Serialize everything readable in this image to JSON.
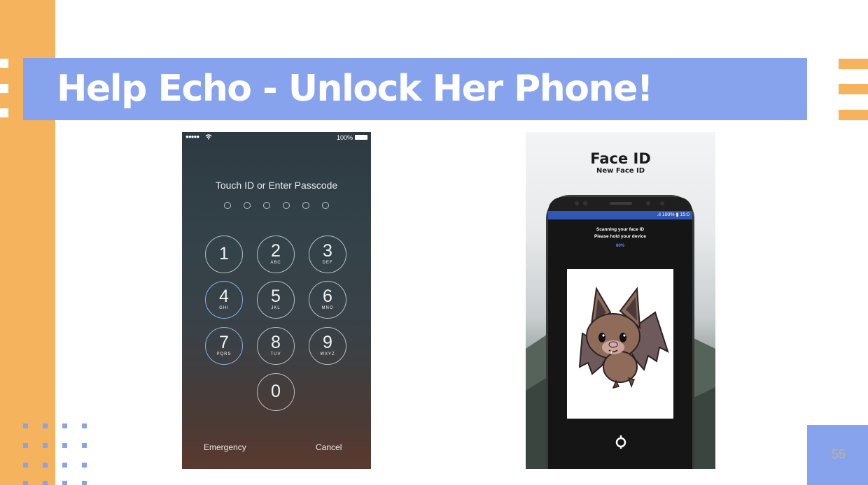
{
  "slide": {
    "title": "Help Echo - Unlock Her Phone!",
    "page_number": "55"
  },
  "colors": {
    "accent_orange": "#f4b35c",
    "accent_blue": "#87a3ee"
  },
  "passcode_screen": {
    "status_signal": "●●●●● ",
    "battery_label": "100%",
    "prompt": "Touch ID or Enter Passcode",
    "keys": [
      {
        "digit": "1",
        "letters": ""
      },
      {
        "digit": "2",
        "letters": "ABC"
      },
      {
        "digit": "3",
        "letters": "DEF"
      },
      {
        "digit": "4",
        "letters": "GHI"
      },
      {
        "digit": "5",
        "letters": "JKL"
      },
      {
        "digit": "6",
        "letters": "MNO"
      },
      {
        "digit": "7",
        "letters": "PQRS"
      },
      {
        "digit": "8",
        "letters": "TUV"
      },
      {
        "digit": "9",
        "letters": "WXYZ"
      },
      {
        "digit": "0",
        "letters": ""
      }
    ],
    "emergency_label": "Emergency",
    "cancel_label": "Cancel"
  },
  "face_id_screen": {
    "title": "Face ID",
    "subtitle": "New Face ID",
    "device_status": ".ıl 100% ▮ 15:0",
    "scan_line1": "Scanning your face ID",
    "scan_line2": "Please hold your device",
    "scan_progress": "80%",
    "scan_icon": "face-scan-icon",
    "image": "bat-cartoon"
  }
}
